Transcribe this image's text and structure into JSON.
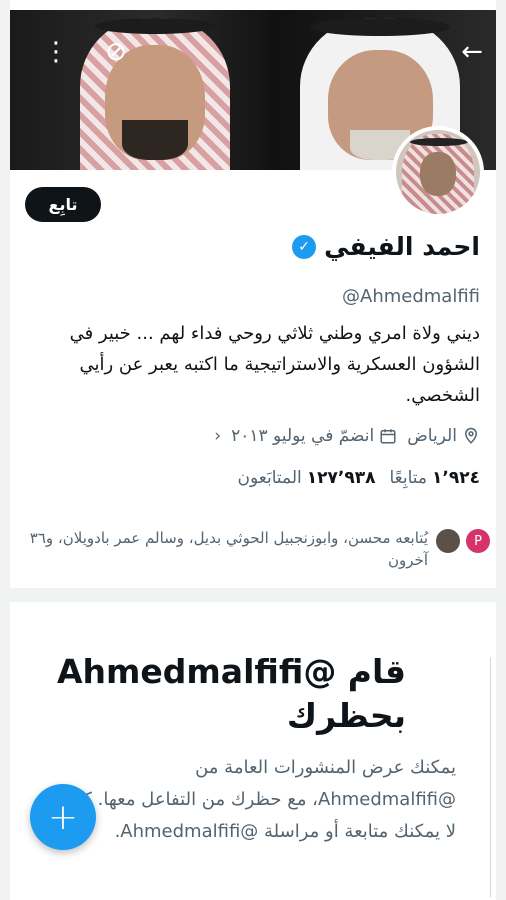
{
  "header": {
    "back_icon": "←",
    "nodisturb_icon": "⊘",
    "menu_icon": "⋮"
  },
  "profile": {
    "follow_label": "تابِع",
    "display_name": "احمد الفيفي",
    "verified_icon": "✓",
    "handle": "@Ahmedmalfifi",
    "bio": "ديني ولاة امري وطني ثلاثي روحي فداء لهم ... خبير في الشؤون العسكرية والاستراتيجية ما اكتبه يعبر عن رأيي الشخصي.",
    "location": "الرياض",
    "joined": "انضمّ في يوليو ٢٠١٣",
    "chevron": "‹",
    "following_count": "١٬٩٢٤",
    "following_label": "متابِعًا",
    "followers_count": "١٢٧٬٩٣٨",
    "followers_label": "المتابَعون",
    "mutual_text": "يُتابعه محسن، وابوزنجبيل الحوثي بديل، وسالم عمر بادويلان، و٣٦ آخرون",
    "mutual_avatar_letter": "P"
  },
  "blocked": {
    "title": "قام @Ahmedmalfifi بحظرك",
    "description": "يمكنك عرض المنشورات العامة من @Ahmedmalfifi، مع حظرك من التفاعل معها. كما لا يمكنك متابعة أو مراسلة @Ahmedmalfifi."
  },
  "fab": {
    "label": "+"
  },
  "colors": {
    "accent": "#1d9bf0",
    "text": "#0f1419",
    "secondary": "#536471"
  }
}
